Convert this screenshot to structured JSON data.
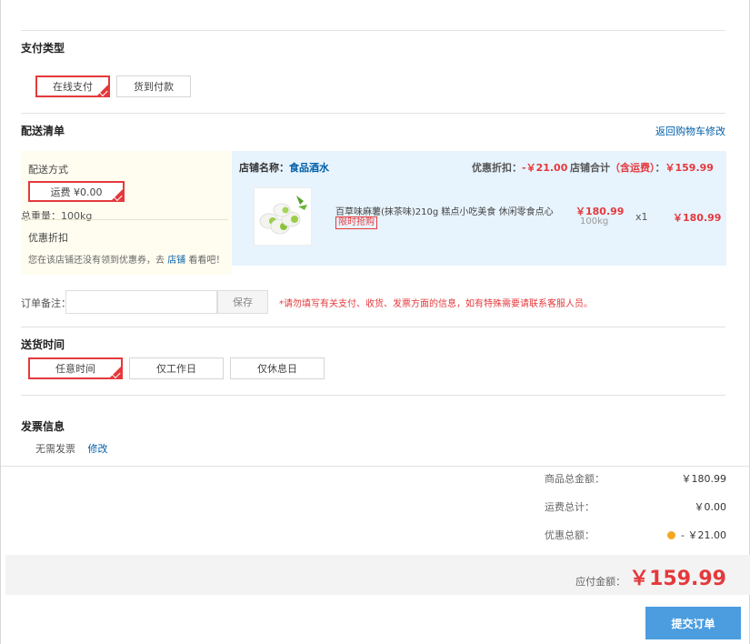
{
  "payment": {
    "title": "支付类型",
    "options": [
      {
        "label": "在线支付",
        "selected": true
      },
      {
        "label": "货到付款",
        "selected": false
      }
    ]
  },
  "delivery": {
    "title": "配送清单",
    "back_link": "返回购物车修改",
    "method_label": "配送方式",
    "shipping_option": "运费 ¥0.00",
    "total_weight": "总重量：100kg",
    "discount_label": "优惠折扣",
    "coupon_text_pre": "您在该店铺还没有领到优惠券，去",
    "coupon_link": "店铺",
    "coupon_text_post": "看看吧！"
  },
  "shop": {
    "name_label": "店铺名称：",
    "name": "食品酒水",
    "discount_label": "优惠折扣：",
    "discount_value": "-￥21.00",
    "total_label": "店铺合计",
    "total_note": "（含运费）",
    "total_colon": "：",
    "total_value": "￥159.99",
    "item": {
      "name": "百草味麻薯(抹茶味)210g 糕点小吃美食 休闲零食点心",
      "tag": "限时抢购",
      "price": "￥180.99",
      "weight": "100kg",
      "qty": "x1",
      "subtotal": "￥180.99"
    }
  },
  "remark": {
    "label": "订单备注：",
    "placeholder": "",
    "save_label": "保存",
    "hint": "*请勿填写有关支付、收货、发票方面的信息，如有特殊需要请联系客服人员。"
  },
  "delivery_time": {
    "title": "送货时间",
    "options": [
      {
        "label": "任意时间",
        "selected": true
      },
      {
        "label": "仅工作日",
        "selected": false
      },
      {
        "label": "仅休息日",
        "selected": false
      }
    ]
  },
  "invoice": {
    "title": "发票信息",
    "value": "无需发票",
    "edit_link": "修改"
  },
  "summary": {
    "goods_label": "商品总金额：",
    "goods_value": "￥180.99",
    "freight_label": "运费总计：",
    "freight_value": "￥0.00",
    "discount_label": "优惠总额：",
    "discount_value": "- ￥21.00",
    "pay_label": "应付金额：",
    "pay_value": "￥159.99",
    "submit_label": "提交订单"
  },
  "colors": {
    "accent_red": "#e4393c",
    "link_blue": "#005ea7",
    "submit_blue": "#4b9ddf"
  }
}
